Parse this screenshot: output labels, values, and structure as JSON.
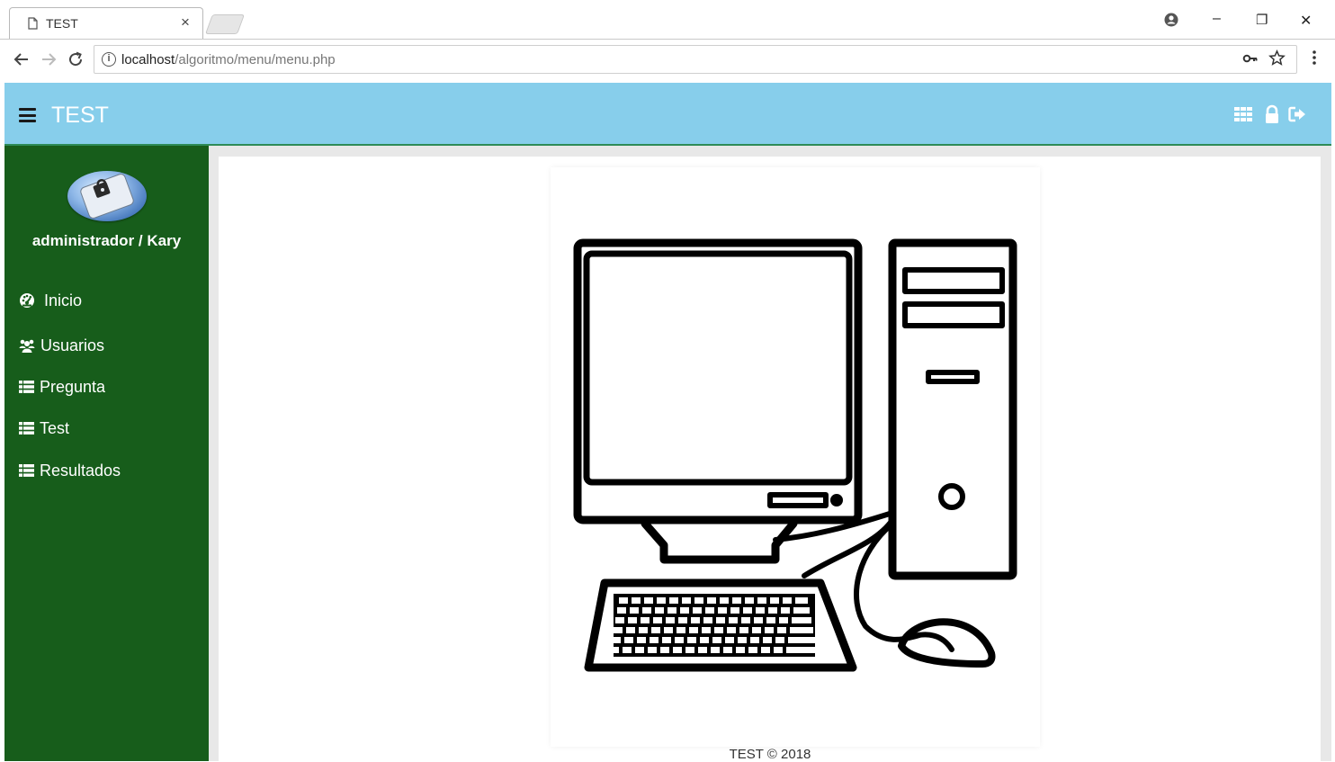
{
  "browser": {
    "tab_title": "TEST",
    "tab_close": "×",
    "url_host": "localhost",
    "url_path": "/algoritmo/menu/menu.php",
    "window_controls": {
      "minimize": "–",
      "restore": "❐",
      "close": "✕"
    }
  },
  "app": {
    "title": "TEST",
    "header_icons": [
      "grid-icon",
      "lock-icon",
      "sign-out-icon"
    ],
    "colors": {
      "header": "#87ceeb",
      "sidebar": "#175d1b"
    }
  },
  "sidebar": {
    "user": "administrador / Kary",
    "items": [
      {
        "label": "Inicio",
        "icon": "dashboard-icon"
      },
      {
        "label": "Usuarios",
        "icon": "users-icon"
      },
      {
        "label": "Pregunta",
        "icon": "list-icon"
      },
      {
        "label": "Test",
        "icon": "list-icon"
      },
      {
        "label": "Resultados",
        "icon": "list-icon"
      }
    ]
  },
  "footer": {
    "text": "TEST © 2018"
  }
}
